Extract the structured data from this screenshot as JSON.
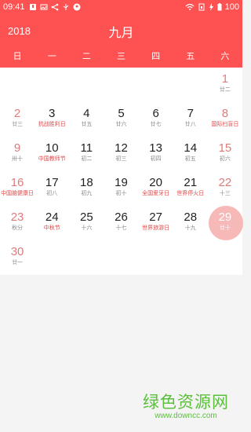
{
  "status_bar": {
    "time": "09:41",
    "battery": "100",
    "icons_left": [
      "notification-icon",
      "image-icon",
      "share-icon",
      "usb-icon",
      "user-icon"
    ],
    "icons_right": [
      "wifi-icon",
      "sim-icon",
      "charging-icon",
      "battery-icon"
    ]
  },
  "header": {
    "year": "2018",
    "month": "九月"
  },
  "weekdays": [
    "日",
    "一",
    "二",
    "三",
    "四",
    "五",
    "六"
  ],
  "colors": {
    "accent": "#fe5252",
    "today_highlight": "#f7b8b8",
    "weekend": "#e07b7b",
    "watermark": "#5cbf3c"
  },
  "days": [
    {
      "day": "1",
      "lunar": "廿二",
      "weekend": true
    },
    {
      "day": "2",
      "lunar": "廿三",
      "weekend": true
    },
    {
      "day": "3",
      "lunar": "抗战胜利日",
      "festival": true
    },
    {
      "day": "4",
      "lunar": "廿五"
    },
    {
      "day": "5",
      "lunar": "廿六"
    },
    {
      "day": "6",
      "lunar": "廿七"
    },
    {
      "day": "7",
      "lunar": "廿八"
    },
    {
      "day": "8",
      "lunar": "国际扫盲日",
      "weekend": true,
      "festival": true
    },
    {
      "day": "9",
      "lunar": "卅十",
      "weekend": true
    },
    {
      "day": "10",
      "lunar": "中国教师节",
      "festival": true
    },
    {
      "day": "11",
      "lunar": "初二"
    },
    {
      "day": "12",
      "lunar": "初三"
    },
    {
      "day": "13",
      "lunar": "初四"
    },
    {
      "day": "14",
      "lunar": "初五"
    },
    {
      "day": "15",
      "lunar": "初六",
      "weekend": true
    },
    {
      "day": "16",
      "lunar": "中国脑健康日",
      "weekend": true,
      "festival": true
    },
    {
      "day": "17",
      "lunar": "初八"
    },
    {
      "day": "18",
      "lunar": "初九"
    },
    {
      "day": "19",
      "lunar": "初十"
    },
    {
      "day": "20",
      "lunar": "全国爱牙日",
      "festival": true
    },
    {
      "day": "21",
      "lunar": "世界停火日",
      "festival": true
    },
    {
      "day": "22",
      "lunar": "十三",
      "weekend": true
    },
    {
      "day": "23",
      "lunar": "秋分",
      "weekend": true
    },
    {
      "day": "24",
      "lunar": "中秋节",
      "festival": true
    },
    {
      "day": "25",
      "lunar": "十六"
    },
    {
      "day": "26",
      "lunar": "十七"
    },
    {
      "day": "27",
      "lunar": "世界旅游日",
      "festival": true
    },
    {
      "day": "28",
      "lunar": "十九"
    },
    {
      "day": "29",
      "lunar": "廿十",
      "weekend": true,
      "today": true
    },
    {
      "day": "30",
      "lunar": "廿一",
      "weekend": true
    }
  ],
  "watermark": {
    "text": "绿色资源网",
    "url": "www.downcc.com"
  }
}
